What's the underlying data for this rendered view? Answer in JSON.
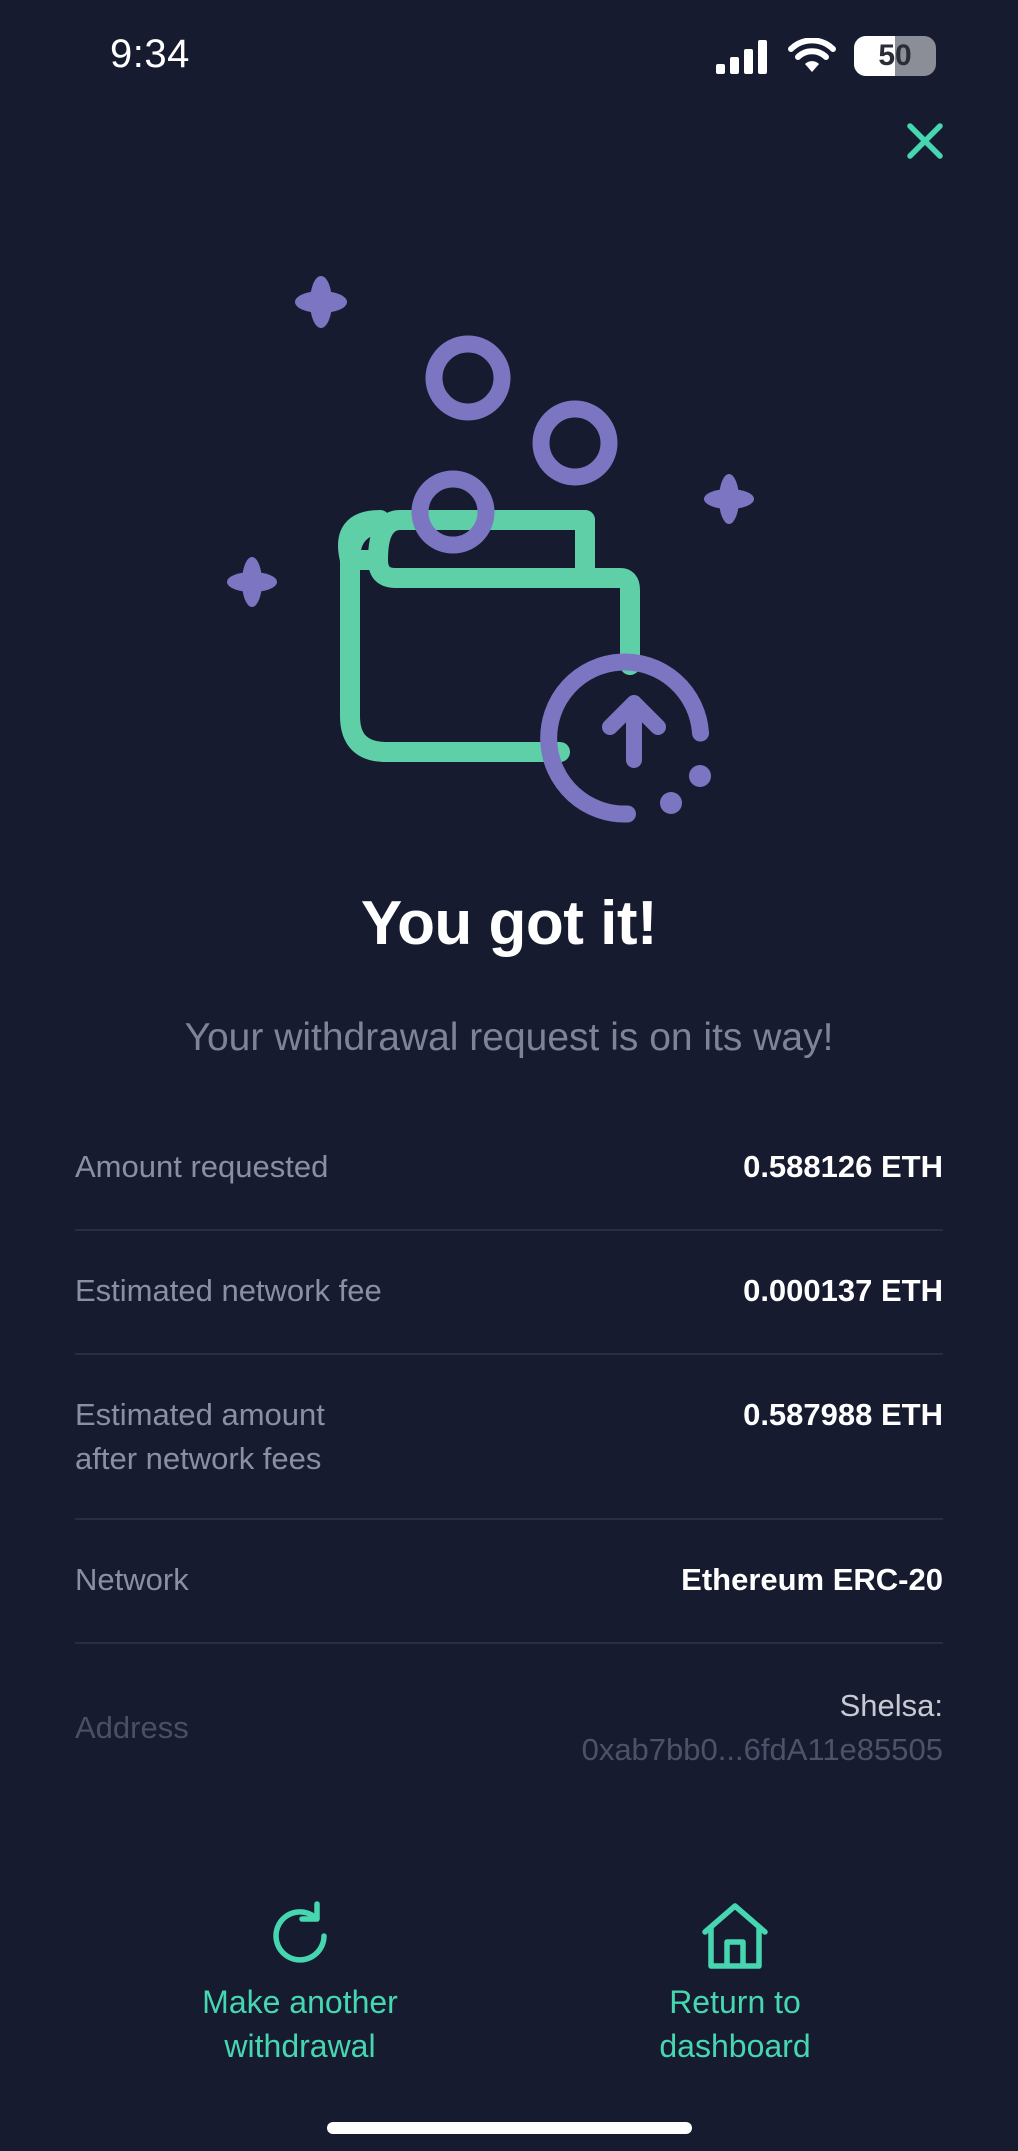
{
  "status_bar": {
    "time": "9:34",
    "battery_level": "50",
    "icons": [
      "cellular-signal-icon",
      "wifi-icon",
      "battery-icon"
    ]
  },
  "header": {
    "close_icon": "close-icon"
  },
  "illustration": {
    "icon": "wallet-withdraw-illustration",
    "colors": {
      "wallet": "#5fcfa8",
      "coins": "#7c76c2"
    }
  },
  "confirmation": {
    "headline": "You got it!",
    "subtitle": "Your withdrawal request is on its way!"
  },
  "details": {
    "amount_requested": {
      "label": "Amount requested",
      "value": "0.588126 ETH"
    },
    "network_fee": {
      "label": "Estimated network fee",
      "value": "0.000137 ETH"
    },
    "amount_after_fees": {
      "label_line1": "Estimated amount",
      "label_line2": "after network fees",
      "value": "0.587988 ETH"
    },
    "network": {
      "label": "Network",
      "value": "Ethereum ERC-20"
    },
    "address": {
      "label": "Address",
      "name": "Shelsa:",
      "hash": "0xab7bb0...6fdA11e85505"
    }
  },
  "actions": {
    "withdraw_again": {
      "line1": "Make another",
      "line2": "withdrawal",
      "icon": "refresh-icon"
    },
    "dashboard": {
      "line1": "Return to",
      "line2": "dashboard",
      "icon": "home-icon"
    }
  },
  "colors": {
    "background": "#161b30",
    "accent": "#46d6b0",
    "muted_text": "#8b8fa3",
    "divider": "#272d45"
  }
}
